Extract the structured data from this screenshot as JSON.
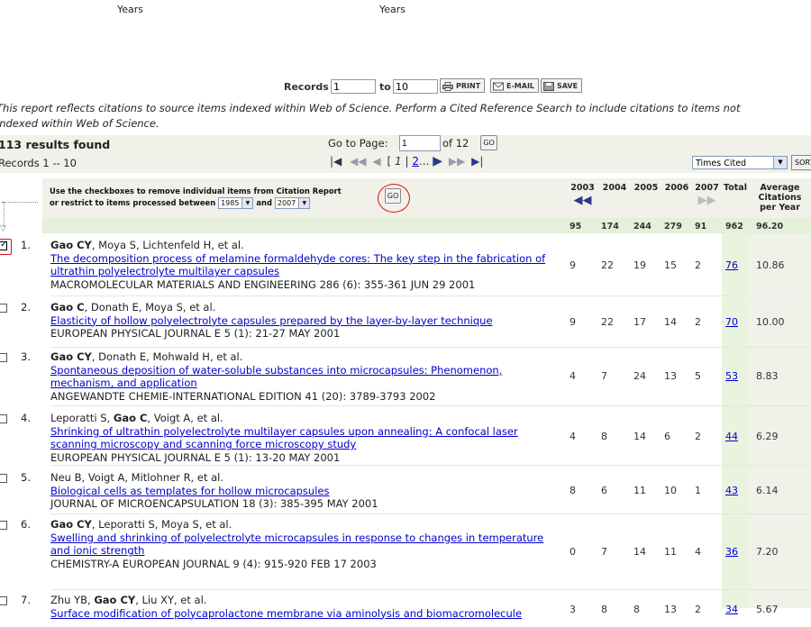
{
  "top_captions": [
    "Years",
    "Years"
  ],
  "records_bar": {
    "label_records": "Records",
    "from_value": "1",
    "label_to": "to",
    "to_value": "10",
    "print_label": "PRINT",
    "email_label": "E-MAIL",
    "save_label": "SAVE"
  },
  "report_note": [
    "This report reflects citations to source items indexed within Web of Science. Perform a Cited Reference Search to include citations to items not",
    "indexed within Web of Science."
  ],
  "results": {
    "found": "113 results found",
    "range": "Records 1 -- 10",
    "goto_label": "Go to Page:",
    "goto_value": "1",
    "of_pages": "of 12",
    "go_label": "GO",
    "page_current": "1",
    "page_next": "2",
    "sort_value": "Times Cited",
    "sort_label": "SORT"
  },
  "header": {
    "instruction_line1": "Use the checkboxes to remove individual items from Citation Report",
    "instruction_line2_prefix": "or restrict to items processed between",
    "year_from": "1985",
    "year_and": "and",
    "year_to": "2007",
    "go_label": "GO",
    "years": [
      "2003",
      "2004",
      "2005",
      "2006",
      "2007"
    ],
    "total_label": "Total",
    "avg_label_1": "Average",
    "avg_label_2": "Citations",
    "avg_label_3": "per Year"
  },
  "totals": {
    "years": [
      "95",
      "174",
      "244",
      "279",
      "91"
    ],
    "total": "962",
    "avg": "96.20"
  },
  "rows": [
    {
      "num": "1.",
      "author_bold": "Gao CY",
      "author_rest": ", Moya S, Lichtenfeld H, et al.",
      "title": "The decomposition process of melamine formaldehyde cores: The key step in the fabrication of ultrathin polyelectrolyte multilayer capsules",
      "source": "MACROMOLECULAR MATERIALS AND ENGINEERING 286 (6): 355-361 JUN 29 2001",
      "years": [
        "9",
        "22",
        "19",
        "15",
        "2"
      ],
      "total": "76",
      "avg": "10.86",
      "checked": true
    },
    {
      "num": "2.",
      "author_bold": "Gao C",
      "author_rest": ", Donath E, Moya S, et al.",
      "title": "Elasticity of hollow polyelectrolyte capsules prepared by the layer-by-layer technique",
      "source": "EUROPEAN PHYSICAL JOURNAL E 5 (1): 21-27 MAY 2001",
      "years": [
        "9",
        "22",
        "17",
        "14",
        "2"
      ],
      "total": "70",
      "avg": "10.00",
      "checked": false
    },
    {
      "num": "3.",
      "author_bold": "Gao CY",
      "author_rest": ", Donath E, Mohwald H, et al.",
      "title": "Spontaneous deposition of water-soluble substances into microcapsules: Phenomenon, mechanism, and application",
      "source": "ANGEWANDTE CHEMIE-INTERNATIONAL EDITION 41 (20): 3789-3793 2002",
      "years": [
        "4",
        "7",
        "24",
        "13",
        "5"
      ],
      "total": "53",
      "avg": "8.83",
      "checked": false
    },
    {
      "num": "4.",
      "author_pre": "Leporatti S, ",
      "author_bold": "Gao C",
      "author_rest": ", Voigt A, et al.",
      "title": "Shrinking of ultrathin polyelectrolyte multilayer capsules upon annealing: A confocal laser scanning microscopy and scanning force microscopy study",
      "source": "EUROPEAN PHYSICAL JOURNAL E 5 (1): 13-20 MAY 2001",
      "years": [
        "4",
        "8",
        "14",
        "6",
        "2"
      ],
      "total": "44",
      "avg": "6.29",
      "checked": false
    },
    {
      "num": "5.",
      "author_plain": "Neu B, Voigt A, Mitlohner R, et al.",
      "title": "Biological cells as templates for hollow microcapsules",
      "source": "JOURNAL OF MICROENCAPSULATION 18 (3): 385-395 MAY 2001",
      "years": [
        "8",
        "6",
        "11",
        "10",
        "1"
      ],
      "total": "43",
      "avg": "6.14",
      "checked": false
    },
    {
      "num": "6.",
      "author_bold": "Gao CY",
      "author_rest": ", Leporatti S, Moya S, et al.",
      "title": "Swelling and shrinking of polyelectrolyte microcapsules in response to changes in temperature and ionic strength",
      "source": "CHEMISTRY-A EUROPEAN JOURNAL 9 (4): 915-920 FEB 17 2003",
      "years": [
        "0",
        "7",
        "14",
        "11",
        "4"
      ],
      "total": "36",
      "avg": "7.20",
      "checked": false
    },
    {
      "num": "7.",
      "author_pre": "Zhu YB, ",
      "author_bold": "Gao CY",
      "author_rest": ", Liu XY, et al.",
      "title": "Surface modification of polycaprolactone membrane via aminolysis and biomacromolecule",
      "source": "",
      "years": [
        "3",
        "8",
        "8",
        "13",
        "2"
      ],
      "total": "34",
      "avg": "5.67",
      "checked": false
    }
  ]
}
